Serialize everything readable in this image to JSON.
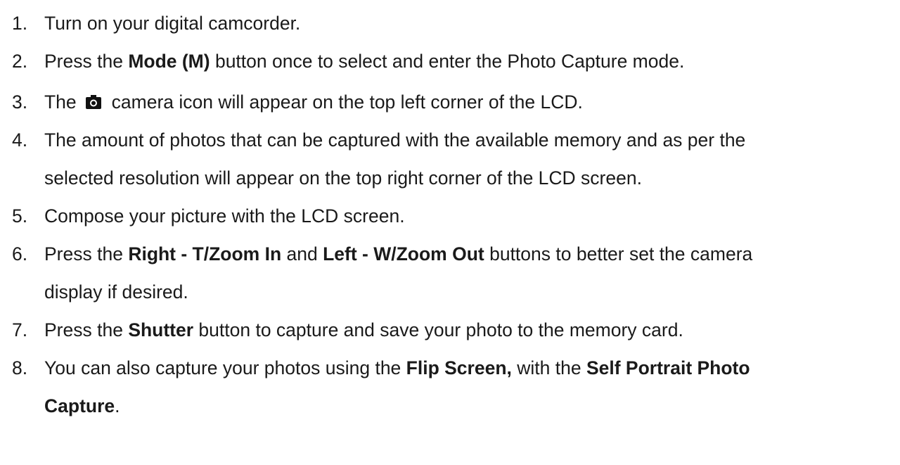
{
  "steps": [
    {
      "number": "1.",
      "parts": [
        {
          "text": "Turn on your digital camcorder.",
          "bold": false
        }
      ]
    },
    {
      "number": "2.",
      "parts": [
        {
          "text": "Press the ",
          "bold": false
        },
        {
          "text": "Mode (M)",
          "bold": true
        },
        {
          "text": " button once to select and enter the Photo Capture mode.",
          "bold": false
        }
      ]
    },
    {
      "number": "3.",
      "parts": [
        {
          "text": "The",
          "bold": false
        },
        {
          "icon": "camera-icon"
        },
        {
          "text": "camera icon will appear on the top left corner of the LCD.",
          "bold": false
        }
      ]
    },
    {
      "number": "4.",
      "lines": [
        [
          {
            "text": "The amount of photos that can be captured with the available memory and as per the",
            "bold": false
          }
        ],
        [
          {
            "text": "selected resolution will appear on the top right corner of the LCD screen.",
            "bold": false
          }
        ]
      ]
    },
    {
      "number": "5.",
      "parts": [
        {
          "text": "Compose your picture with the LCD screen.",
          "bold": false
        }
      ]
    },
    {
      "number": "6.",
      "lines": [
        [
          {
            "text": "Press the ",
            "bold": false
          },
          {
            "text": "Right - T/Zoom In",
            "bold": true
          },
          {
            "text": " and ",
            "bold": false
          },
          {
            "text": "Left - W/Zoom Out",
            "bold": true
          },
          {
            "text": " buttons to better set the camera",
            "bold": false
          }
        ],
        [
          {
            "text": "display if desired.",
            "bold": false
          }
        ]
      ]
    },
    {
      "number": "7.",
      "parts": [
        {
          "text": "Press the ",
          "bold": false
        },
        {
          "text": "Shutter",
          "bold": true
        },
        {
          "text": " button to capture and save your photo to the memory card.",
          "bold": false
        }
      ]
    },
    {
      "number": "8.",
      "lines": [
        [
          {
            "text": "You can also capture your photos using the ",
            "bold": false
          },
          {
            "text": "Flip Screen,",
            "bold": true
          },
          {
            "text": " with the ",
            "bold": false
          },
          {
            "text": "Self Portrait Photo",
            "bold": true
          }
        ],
        [
          {
            "text": "Capture",
            "bold": true
          },
          {
            "text": ".",
            "bold": false
          }
        ]
      ]
    }
  ]
}
